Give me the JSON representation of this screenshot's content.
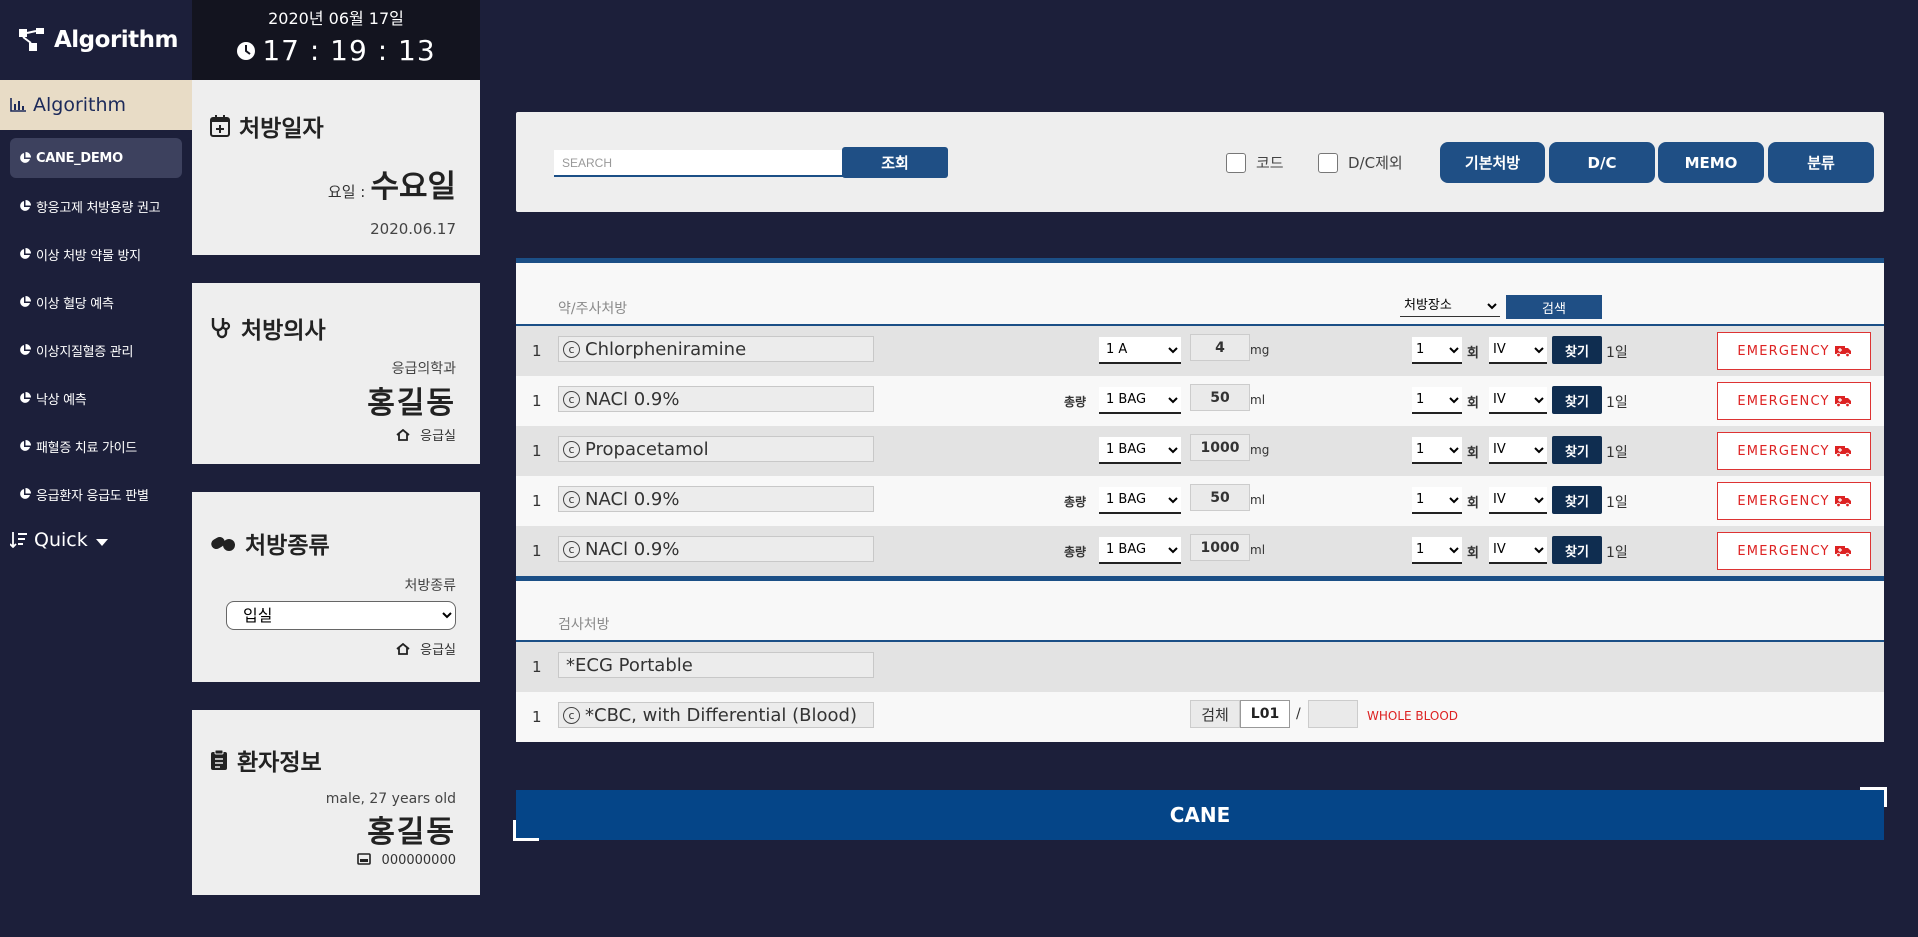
{
  "sidebar": {
    "logo": "Algorithm",
    "section": "Algorithm",
    "items": [
      {
        "label": "CANE_DEMO"
      },
      {
        "label": "항응고제 처방용량 권고"
      },
      {
        "label": "이상 처방 약물 방지"
      },
      {
        "label": "이상 혈당 예측"
      },
      {
        "label": "이상지질혈증 관리"
      },
      {
        "label": "낙상 예측"
      },
      {
        "label": "패혈증 치료 가이드"
      },
      {
        "label": "응급환자 응급도 판별"
      }
    ],
    "quick": "Quick"
  },
  "clock": {
    "date": "2020년 06월 17일",
    "time": "17 : 19 : 13"
  },
  "rx_date": {
    "title": "처방일자",
    "weekday_prefix": "요일 :",
    "weekday": "수요일",
    "date": "2020.06.17"
  },
  "doctor": {
    "title": "처방의사",
    "department": "응급의학과",
    "name": "홍길동",
    "location": "응급실"
  },
  "rx_type": {
    "title": "처방종류",
    "label": "처방종류",
    "selected": "입실",
    "location": "응급실"
  },
  "patient": {
    "title": "환자정보",
    "summary": "male, 27 years old",
    "name": "홍길동",
    "id": "000000000"
  },
  "toolbar": {
    "search_placeholder": "SEARCH",
    "lookup": "조회",
    "chk_code": "코드",
    "chk_dc": "D/C제외",
    "btn_basic": "기본처방",
    "btn_dc": "D/C",
    "btn_memo": "MEMO",
    "btn_class": "분류"
  },
  "drug_section": {
    "label": "약/주사처방",
    "place_select": "처방장소",
    "search": "검색",
    "rows": [
      {
        "num": "1",
        "name": "Chlorpheniramine",
        "total": "",
        "unit": "1 A",
        "dose": "4",
        "dose_unit": "mg",
        "freq": "1",
        "freq_label": "회",
        "route": "IV",
        "find": "찾기",
        "days": "1일",
        "emergency": "EMERGENCY"
      },
      {
        "num": "1",
        "name": "NACl 0.9%",
        "total": "총량",
        "unit": "1 BAG",
        "dose": "50",
        "dose_unit": "ml",
        "freq": "1",
        "freq_label": "회",
        "route": "IV",
        "find": "찾기",
        "days": "1일",
        "emergency": "EMERGENCY"
      },
      {
        "num": "1",
        "name": "Propacetamol",
        "total": "",
        "unit": "1 BAG",
        "dose": "1000",
        "dose_unit": "mg",
        "freq": "1",
        "freq_label": "회",
        "route": "IV",
        "find": "찾기",
        "days": "1일",
        "emergency": "EMERGENCY"
      },
      {
        "num": "1",
        "name": "NACl 0.9%",
        "total": "총량",
        "unit": "1 BAG",
        "dose": "50",
        "dose_unit": "ml",
        "freq": "1",
        "freq_label": "회",
        "route": "IV",
        "find": "찾기",
        "days": "1일",
        "emergency": "EMERGENCY"
      },
      {
        "num": "1",
        "name": "NACl 0.9%",
        "total": "총량",
        "unit": "1 BAG",
        "dose": "1000",
        "dose_unit": "ml",
        "freq": "1",
        "freq_label": "회",
        "route": "IV",
        "find": "찾기",
        "days": "1일",
        "emergency": "EMERGENCY"
      }
    ]
  },
  "exam_section": {
    "label": "검사처방",
    "rows": [
      {
        "num": "1",
        "name": "*ECG Portable"
      },
      {
        "num": "1",
        "name": "*CBC, with Differential (Blood)",
        "spec_label": "검체",
        "spec_code": "L01",
        "slash": "/",
        "spec_name": "WHOLE BLOOD"
      }
    ]
  },
  "cane_button": "CANE",
  "colors": {
    "background": "#1c1f3a",
    "primary": "#1f4f85",
    "emergency": "#dd2222",
    "active_nav": "#e8dcc6"
  }
}
